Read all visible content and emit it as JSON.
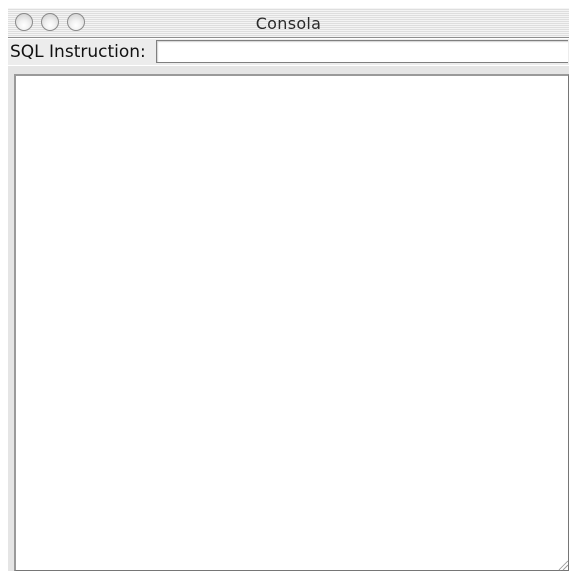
{
  "window": {
    "title": "Consola"
  },
  "sql": {
    "label": "SQL Instruction:",
    "value": "",
    "placeholder": ""
  },
  "output": {
    "text": ""
  },
  "icons": {
    "close": "close-icon",
    "minimize": "minimize-icon",
    "zoom": "zoom-icon",
    "grip": "resize-grip-icon"
  }
}
